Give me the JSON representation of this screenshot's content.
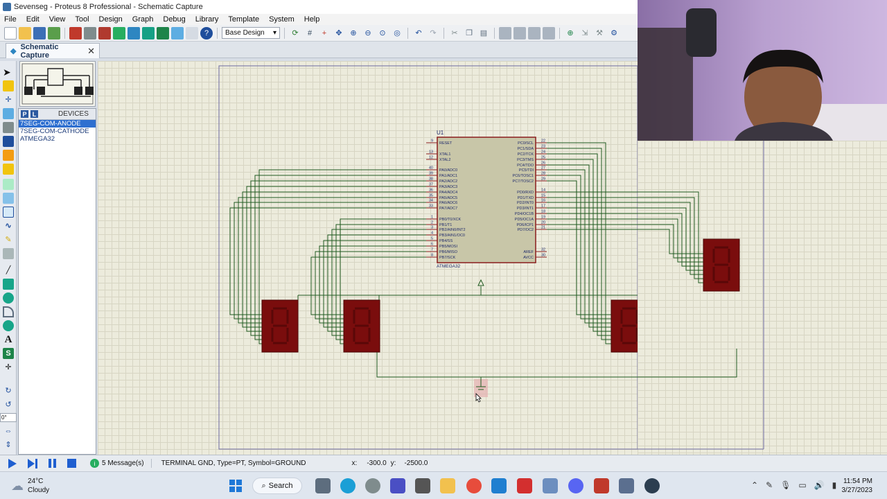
{
  "window": {
    "title": "Sevenseg - Proteus 8 Professional - Schematic Capture"
  },
  "menu": [
    "File",
    "Edit",
    "View",
    "Tool",
    "Design",
    "Graph",
    "Debug",
    "Library",
    "Template",
    "System",
    "Help"
  ],
  "toolbar": {
    "design_select": "Base Design"
  },
  "tab": {
    "label": "Schematic Capture"
  },
  "devices": {
    "header": "DEVICES",
    "p_label": "P",
    "l_label": "L",
    "items": [
      "7SEG-COM-ANODE",
      "7SEG-COM-CATHODE",
      "ATMEGA32"
    ],
    "selected_index": 0
  },
  "left_tools": {
    "rotation": "0°"
  },
  "schematic": {
    "chip": {
      "ref": "U1",
      "part": "ATMEGA32",
      "left_pins": [
        {
          "num": "9",
          "name": "RESET"
        },
        {
          "num": "13",
          "name": "XTAL1"
        },
        {
          "num": "12",
          "name": "XTAL2"
        },
        {
          "num": "40",
          "name": "PA0/ADC0"
        },
        {
          "num": "39",
          "name": "PA1/ADC1"
        },
        {
          "num": "38",
          "name": "PA2/ADC2"
        },
        {
          "num": "37",
          "name": "PA3/ADC3"
        },
        {
          "num": "36",
          "name": "PA4/ADC4"
        },
        {
          "num": "35",
          "name": "PA5/ADC5"
        },
        {
          "num": "34",
          "name": "PA6/ADC6"
        },
        {
          "num": "33",
          "name": "PA7/ADC7"
        },
        {
          "num": "1",
          "name": "PB0/T0/XCK"
        },
        {
          "num": "2",
          "name": "PB1/T1"
        },
        {
          "num": "3",
          "name": "PB2/AIN0/INT2"
        },
        {
          "num": "4",
          "name": "PB3/AIN1/OC0"
        },
        {
          "num": "5",
          "name": "PB4/SS"
        },
        {
          "num": "6",
          "name": "PB5/MOSI"
        },
        {
          "num": "7",
          "name": "PB6/MISO"
        },
        {
          "num": "8",
          "name": "PB7/SCK"
        }
      ],
      "right_pins": [
        {
          "num": "22",
          "name": "PC0/SCL"
        },
        {
          "num": "23",
          "name": "PC1/SDA"
        },
        {
          "num": "24",
          "name": "PC2/TCK"
        },
        {
          "num": "25",
          "name": "PC3/TMS"
        },
        {
          "num": "26",
          "name": "PC4/TDO"
        },
        {
          "num": "27",
          "name": "PC5/TDI"
        },
        {
          "num": "28",
          "name": "PC6/TOSC1"
        },
        {
          "num": "29",
          "name": "PC7/TOSC2"
        },
        {
          "num": "14",
          "name": "PD0/RXD"
        },
        {
          "num": "15",
          "name": "PD1/TXD"
        },
        {
          "num": "16",
          "name": "PD2/INT0"
        },
        {
          "num": "17",
          "name": "PD3/INT1"
        },
        {
          "num": "18",
          "name": "PD4/OC1B"
        },
        {
          "num": "19",
          "name": "PD5/OC1A"
        },
        {
          "num": "20",
          "name": "PD6/ICP1"
        },
        {
          "num": "21",
          "name": "PD7/OC2"
        },
        {
          "num": "32",
          "name": "AREF"
        },
        {
          "num": "30",
          "name": "AVCC"
        }
      ]
    }
  },
  "status": {
    "messages": "5 Message(s)",
    "info": "TERMINAL GND, Type=PT, Symbol=GROUND",
    "x_label": "x:",
    "x_value": "-300.0",
    "y_label": "y:",
    "y_value": "-2500.0"
  },
  "taskbar": {
    "weather_temp": "24°C",
    "weather_desc": "Cloudy",
    "search": "Search",
    "time": "11:54 PM",
    "date": "3/27/2023"
  },
  "colors": {
    "wire": "#1f5a1f",
    "chip_fill": "#c8c6a8",
    "chip_border": "#8a1c1c",
    "segment": "#7a0d0d",
    "selection": "#2e6fd0"
  }
}
